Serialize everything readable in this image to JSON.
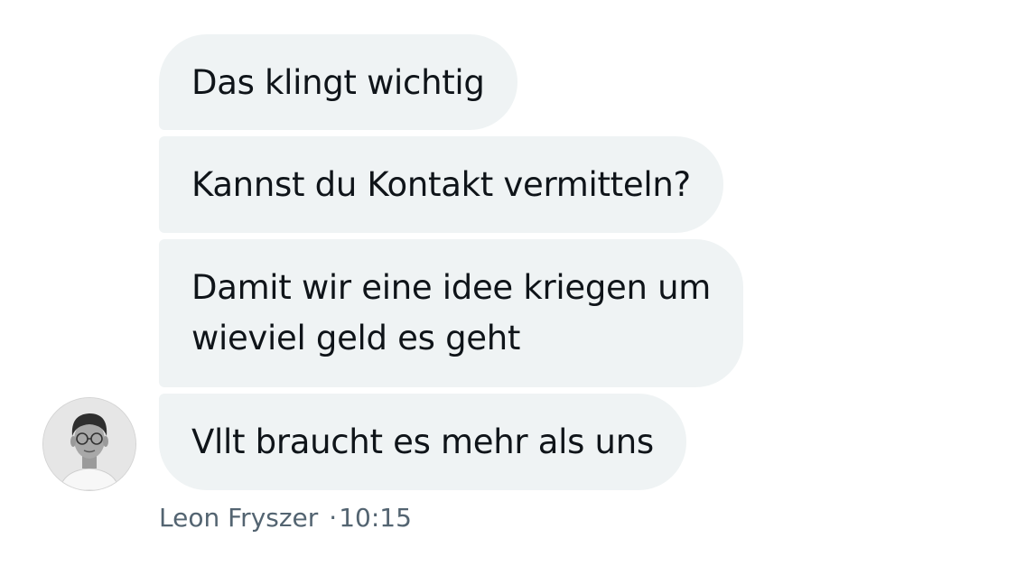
{
  "messages": [
    {
      "lines": [
        "Das klingt wichtig"
      ]
    },
    {
      "lines": [
        "Kannst du Kontakt vermitteln?"
      ]
    },
    {
      "lines": [
        "Damit wir eine idee kriegen um",
        "wieviel geld es geht"
      ]
    },
    {
      "lines": [
        "Vllt braucht es mehr als uns"
      ]
    }
  ],
  "sender": {
    "name": "Leon Fryszer",
    "separator": "·",
    "time": "10:15"
  },
  "colors": {
    "bubble_bg": "#eff3f4",
    "text": "#0f1419",
    "meta_text": "#536471"
  }
}
